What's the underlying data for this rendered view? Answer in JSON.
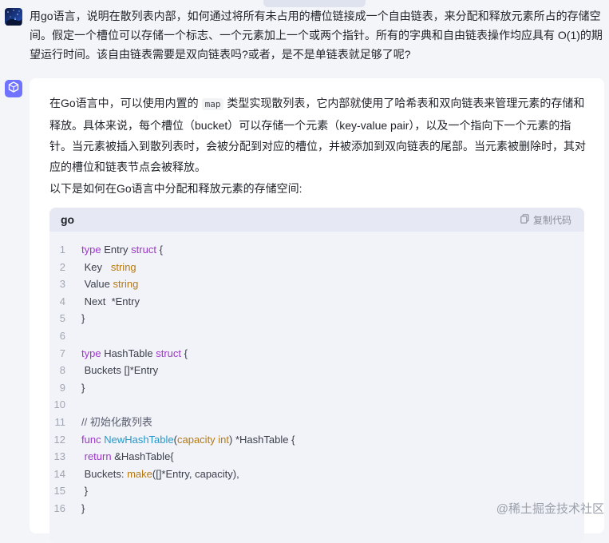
{
  "question": {
    "text": "用go语言，说明在散列表内部，如何通过将所有未占用的槽位链接成一个自由链表，来分配和释放元素所占的存储空间。假定一个槽位可以存储一个标志、一个元素加上一个或两个指针。所有的字典和自由链表操作均应具有 O(1)的期望运行时间。该自由链表需要是双向链表吗?或者，是不是单链表就足够了呢?"
  },
  "answer": {
    "p1_before": "在Go语言中，可以使用内置的 ",
    "p1_code": "map",
    "p1_after": " 类型实现散列表，它内部就使用了哈希表和双向链表来管理元素的存储和释放。具体来说，每个槽位（bucket）可以存储一个元素（key-value pair），以及一个指向下一个元素的指针。当元素被插入到散列表时，会被分配到对应的槽位，并被添加到双向链表的尾部。当元素被删除时，其对应的槽位和链表节点会被释放。",
    "p2": "以下是如何在Go语言中分配和释放元素的存储空间:"
  },
  "code": {
    "language": "go",
    "copy_label": "复制代码",
    "lines": [
      {
        "n": "1",
        "segs": [
          {
            "t": "type",
            "c": "kw"
          },
          {
            "t": " Entry ",
            "c": ""
          },
          {
            "t": "struct",
            "c": "kw"
          },
          {
            "t": " {",
            "c": ""
          }
        ]
      },
      {
        "n": "2",
        "segs": [
          {
            "t": " Key   ",
            "c": ""
          },
          {
            "t": "string",
            "c": "ty"
          }
        ]
      },
      {
        "n": "3",
        "segs": [
          {
            "t": " Value ",
            "c": ""
          },
          {
            "t": "string",
            "c": "ty"
          }
        ]
      },
      {
        "n": "4",
        "segs": [
          {
            "t": " Next  *Entry",
            "c": ""
          }
        ]
      },
      {
        "n": "5",
        "segs": [
          {
            "t": "}",
            "c": ""
          }
        ]
      },
      {
        "n": "6",
        "segs": []
      },
      {
        "n": "7",
        "segs": [
          {
            "t": "type",
            "c": "kw"
          },
          {
            "t": " HashTable ",
            "c": ""
          },
          {
            "t": "struct",
            "c": "kw"
          },
          {
            "t": " {",
            "c": ""
          }
        ]
      },
      {
        "n": "8",
        "segs": [
          {
            "t": " Buckets []*Entry",
            "c": ""
          }
        ]
      },
      {
        "n": "9",
        "segs": [
          {
            "t": "}",
            "c": ""
          }
        ]
      },
      {
        "n": "10",
        "segs": []
      },
      {
        "n": "11",
        "segs": [
          {
            "t": "// 初始化散列表",
            "c": "cm"
          }
        ]
      },
      {
        "n": "12",
        "segs": [
          {
            "t": "func",
            "c": "kw"
          },
          {
            "t": " ",
            "c": ""
          },
          {
            "t": "NewHashTable",
            "c": "fn"
          },
          {
            "t": "(",
            "c": ""
          },
          {
            "t": "capacity int",
            "c": "ty"
          },
          {
            "t": ") *HashTable {",
            "c": ""
          }
        ]
      },
      {
        "n": "13",
        "segs": [
          {
            "t": " ",
            "c": ""
          },
          {
            "t": "return",
            "c": "kw"
          },
          {
            "t": " &HashTable{",
            "c": ""
          }
        ]
      },
      {
        "n": "14",
        "segs": [
          {
            "t": " Buckets: ",
            "c": ""
          },
          {
            "t": "make",
            "c": "ty"
          },
          {
            "t": "([]*Entry, capacity),",
            "c": ""
          }
        ]
      },
      {
        "n": "15",
        "segs": [
          {
            "t": " }",
            "c": ""
          }
        ]
      },
      {
        "n": "16",
        "segs": [
          {
            "t": "}",
            "c": ""
          }
        ]
      }
    ]
  },
  "watermark": "@稀土掘金技术社区",
  "icons": {
    "user_avatar": "starry-night-avatar-icon",
    "bot_avatar": "cube-logo-icon",
    "copy": "copy-icon"
  },
  "colors": {
    "page_bg": "#f4f5f9",
    "card_bg": "#ffffff",
    "code_bg": "#f2f3f8",
    "code_header_bg": "#e6e8f3",
    "bot_avatar": "#6f73ff",
    "keyword": "#9b37c8",
    "type": "#b47a14",
    "function": "#2797c9"
  }
}
